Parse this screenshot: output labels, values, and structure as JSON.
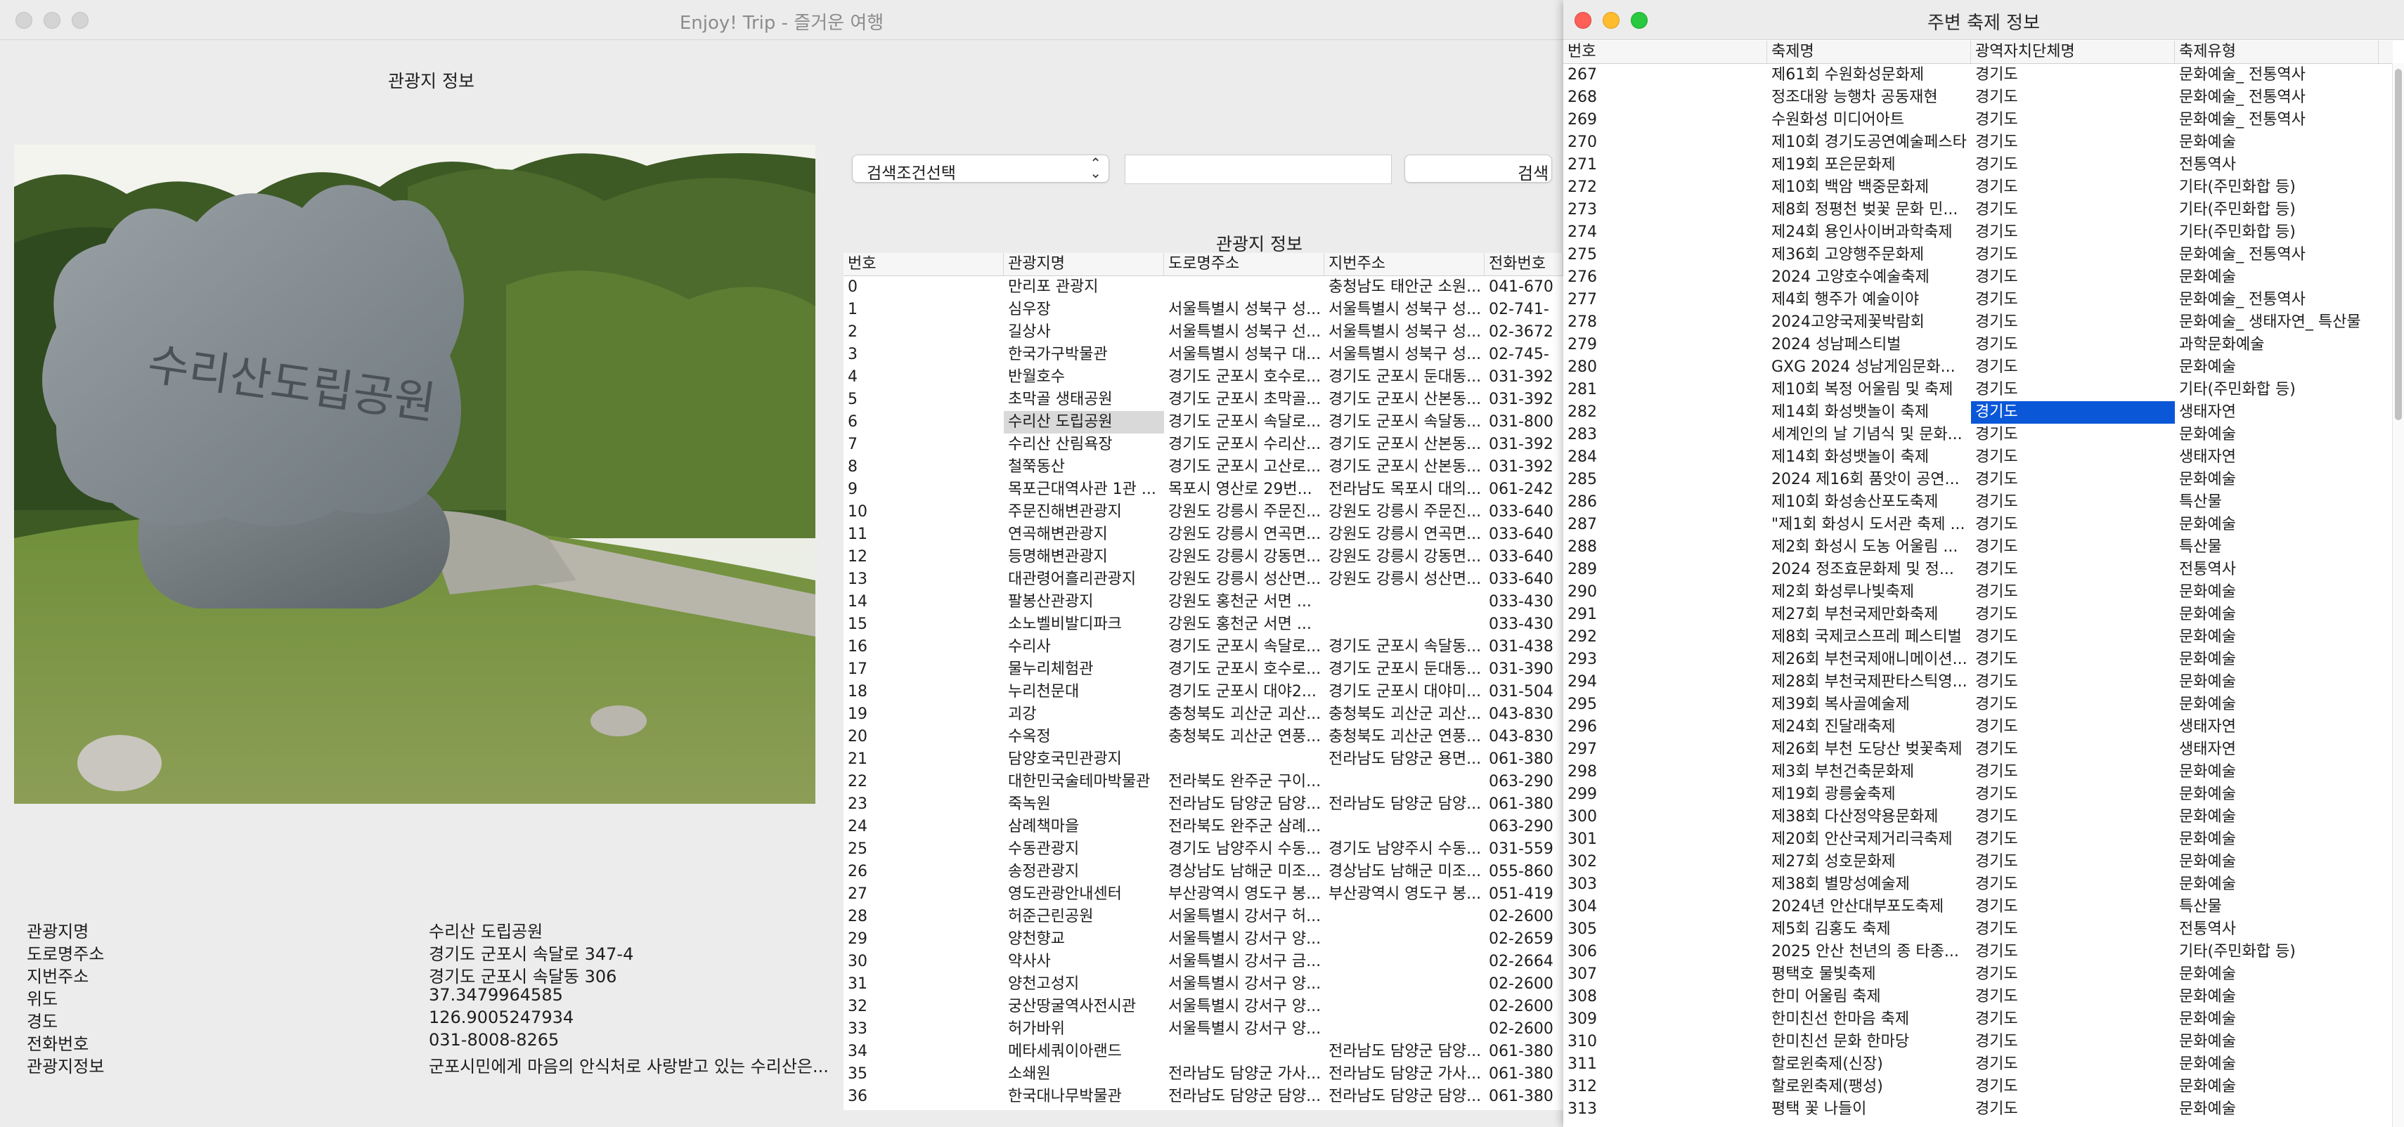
{
  "main_window": {
    "title": "Enjoy! Trip - 즐거운 여행",
    "heading": "관광지 정보",
    "detail": [
      {
        "label": "관광지명",
        "value": "수리산 도립공원"
      },
      {
        "label": "도로명주소",
        "value": "경기도 군포시 속달로 347-4"
      },
      {
        "label": "지번주소",
        "value": "경기도 군포시 속달동 306"
      },
      {
        "label": "위도",
        "value": "37.3479964585"
      },
      {
        "label": "경도",
        "value": "126.9005247934"
      },
      {
        "label": "전화번호",
        "value": "031-8008-8265"
      },
      {
        "label": "관광지정보",
        "value": "군포시민에게 마음의 안식처로 사랑받고 있는 수리산은..."
      }
    ],
    "photo_sign_text": "수리산도립공원"
  },
  "search": {
    "condition_select": "검색조건선택",
    "input_value": "",
    "button_label": "검색"
  },
  "attraction_table": {
    "caption": "관광지 정보",
    "columns": [
      "번호",
      "관광지명",
      "도로명주소",
      "지번주소",
      "전화번호"
    ],
    "selected_row": 6,
    "rows": [
      [
        "0",
        "만리포 관광지",
        "",
        "충청남도 태안군 소원...",
        "041-670"
      ],
      [
        "1",
        "심우장",
        "서울특별시 성북구 성...",
        "서울특별시 성북구 성...",
        "02-741-"
      ],
      [
        "2",
        "길상사",
        "서울특별시 성북구 선...",
        "서울특별시 성북구 성...",
        "02-3672"
      ],
      [
        "3",
        "한국가구박물관",
        "서울특별시 성북구 대...",
        "서울특별시 성북구 성...",
        "02-745-"
      ],
      [
        "4",
        "반월호수",
        "경기도 군포시 호수로...",
        "경기도 군포시 둔대동...",
        "031-392"
      ],
      [
        "5",
        "초막골 생태공원",
        "경기도 군포시 초막골...",
        "경기도 군포시 산본동...",
        "031-392"
      ],
      [
        "6",
        "수리산 도립공원",
        "경기도 군포시 속달로...",
        "경기도 군포시 속달동...",
        "031-800"
      ],
      [
        "7",
        "수리산 산림욕장",
        "경기도 군포시 수리산...",
        "경기도 군포시 산본동...",
        "031-392"
      ],
      [
        "8",
        "철쭉동산",
        "경기도 군포시 고산로...",
        "경기도 군포시 산본동...",
        "031-392"
      ],
      [
        "9",
        "목포근대역사관 1관 ...",
        "목포시 영산로 29번...",
        "전라남도 목포시 대의...",
        "061-242"
      ],
      [
        "10",
        "주문진해변관광지",
        "강원도 강릉시 주문진...",
        "강원도 강릉시 주문진...",
        "033-640"
      ],
      [
        "11",
        "연곡해변관광지",
        "강원도 강릉시 연곡면...",
        "강원도 강릉시 연곡면...",
        "033-640"
      ],
      [
        "12",
        "등명해변관광지",
        "강원도 강릉시 강동면...",
        "강원도 강릉시 강동면...",
        "033-640"
      ],
      [
        "13",
        "대관령어흘리관광지",
        "강원도 강릉시 성산면...",
        "강원도 강릉시 성산면...",
        "033-640"
      ],
      [
        "14",
        "팔봉산관광지",
        "강원도 홍천군 서면 ...",
        "",
        "033-430"
      ],
      [
        "15",
        "소노벨비발디파크",
        "강원도 홍천군 서면 ...",
        "",
        "033-430"
      ],
      [
        "16",
        "수리사",
        "경기도 군포시 속달로...",
        "경기도 군포시 속달동...",
        "031-438"
      ],
      [
        "17",
        "물누리체험관",
        "경기도 군포시 호수로...",
        "경기도 군포시 둔대동...",
        "031-390"
      ],
      [
        "18",
        "누리천문대",
        "경기도 군포시 대야2...",
        "경기도 군포시 대야미...",
        "031-504"
      ],
      [
        "19",
        "괴강",
        "충청북도 괴산군 괴산...",
        "충청북도 괴산군 괴산...",
        "043-830"
      ],
      [
        "20",
        "수옥정",
        "충청북도 괴산군 연풍...",
        "충청북도 괴산군 연풍...",
        "043-830"
      ],
      [
        "21",
        "담양호국민관광지",
        "",
        "전라남도 담양군 용면...",
        "061-380"
      ],
      [
        "22",
        "대한민국술테마박물관",
        "전라북도 완주군 구이...",
        "",
        "063-290"
      ],
      [
        "23",
        "죽녹원",
        "전라남도 담양군 담양...",
        "전라남도 담양군 담양...",
        "061-380"
      ],
      [
        "24",
        "삼례책마을",
        "전라북도 완주군 삼례...",
        "",
        "063-290"
      ],
      [
        "25",
        "수동관광지",
        "경기도 남양주시 수동...",
        "경기도 남양주시 수동...",
        "031-559"
      ],
      [
        "26",
        "송정관광지",
        "경상남도 남해군 미조...",
        "경상남도 남해군 미조...",
        "055-860"
      ],
      [
        "27",
        "영도관광안내센터",
        "부산광역시 영도구 봉...",
        "부산광역시 영도구 봉...",
        "051-419"
      ],
      [
        "28",
        "허준근린공원",
        "서울특별시 강서구 허...",
        "",
        "02-2600"
      ],
      [
        "29",
        "양천향교",
        "서울특별시 강서구 양...",
        "",
        "02-2659"
      ],
      [
        "30",
        "약사사",
        "서울특별시 강서구 금...",
        "",
        "02-2664"
      ],
      [
        "31",
        "양천고성지",
        "서울특별시 강서구 양...",
        "",
        "02-2600"
      ],
      [
        "32",
        "궁산땅굴역사전시관",
        "서울특별시 강서구 양...",
        "",
        "02-2600"
      ],
      [
        "33",
        "허가바위",
        "서울특별시 강서구 양...",
        "",
        "02-2600"
      ],
      [
        "34",
        "메타세쿼이아랜드",
        "",
        "전라남도 담양군 담양...",
        "061-380"
      ],
      [
        "35",
        "소쇄원",
        "전라남도 담양군 가사...",
        "전라남도 담양군 가사...",
        "061-380"
      ],
      [
        "36",
        "한국대나무박물관",
        "전라남도 담양군 담양...",
        "전라남도 담양군 담양...",
        "061-380"
      ]
    ]
  },
  "festival_window": {
    "title": "주변 축제 정보",
    "columns": [
      "번호",
      "축제명",
      "광역자치단체명",
      "축제유형"
    ],
    "selected_row_number": "282",
    "rows": [
      [
        "267",
        "제61회 수원화성문화제",
        "경기도",
        "문화예술_ 전통역사"
      ],
      [
        "268",
        "정조대왕 능행차 공동재현",
        "경기도",
        "문화예술_ 전통역사"
      ],
      [
        "269",
        "수원화성 미디어아트",
        "경기도",
        "문화예술_ 전통역사"
      ],
      [
        "270",
        "제10회 경기도공연예술페스타",
        "경기도",
        "문화예술"
      ],
      [
        "271",
        "제19회 포은문화제",
        "경기도",
        "전통역사"
      ],
      [
        "272",
        "제10회 백암 백중문화제",
        "경기도",
        "기타(주민화합 등)"
      ],
      [
        "273",
        "제8회 정평천 벚꽃 문화 민...",
        "경기도",
        "기타(주민화합 등)"
      ],
      [
        "274",
        "제24회 용인사이버과학축제",
        "경기도",
        "기타(주민화합 등)"
      ],
      [
        "275",
        "제36회 고양행주문화제",
        "경기도",
        "문화예술_ 전통역사"
      ],
      [
        "276",
        "2024 고양호수예술축제",
        "경기도",
        "문화예술"
      ],
      [
        "277",
        "제4회 행주가 예술이야",
        "경기도",
        "문화예술_ 전통역사"
      ],
      [
        "278",
        "2024고양국제꽃박람회",
        "경기도",
        "문화예술_ 생태자연_ 특산물"
      ],
      [
        "279",
        "2024 성남페스티벌",
        "경기도",
        "과학문화예술"
      ],
      [
        "280",
        "GXG 2024 성남게임문화...",
        "경기도",
        "문화예술"
      ],
      [
        "281",
        "제10회 복정 어울림 및 축제",
        "경기도",
        "기타(주민화합 등)"
      ],
      [
        "282",
        "제14회 화성뱃놀이 축제",
        "경기도",
        "생태자연"
      ],
      [
        "283",
        "세계인의 날 기념식 및 문화...",
        "경기도",
        "문화예술"
      ],
      [
        "284",
        "제14회 화성뱃놀이 축제",
        "경기도",
        "생태자연"
      ],
      [
        "285",
        "2024 제16회 품앗이 공연...",
        "경기도",
        "문화예술"
      ],
      [
        "286",
        "제10회 화성송산포도축제",
        "경기도",
        "특산물"
      ],
      [
        "287",
        "\"제1회 화성시 도서관 축제 ...",
        "경기도",
        "문화예술"
      ],
      [
        "288",
        "제2회 화성시 도농 어울림 ...",
        "경기도",
        "특산물"
      ],
      [
        "289",
        "2024 정조효문화제 및 정...",
        "경기도",
        "전통역사"
      ],
      [
        "290",
        "제2회 화성루나빛축제",
        "경기도",
        "문화예술"
      ],
      [
        "291",
        "제27회 부천국제만화축제",
        "경기도",
        "문화예술"
      ],
      [
        "292",
        "제8회 국제코스프레 페스티벌",
        "경기도",
        "문화예술"
      ],
      [
        "293",
        "제26회 부천국제애니메이션...",
        "경기도",
        "문화예술"
      ],
      [
        "294",
        "제28회 부천국제판타스틱영...",
        "경기도",
        "문화예술"
      ],
      [
        "295",
        "제39회 복사골예술제",
        "경기도",
        "문화예술"
      ],
      [
        "296",
        "제24회 진달래축제",
        "경기도",
        "생태자연"
      ],
      [
        "297",
        "제26회 부천 도당산 벚꽃축제",
        "경기도",
        "생태자연"
      ],
      [
        "298",
        "제3회 부천건축문화제",
        "경기도",
        "문화예술"
      ],
      [
        "299",
        "제19회 광릉숲축제",
        "경기도",
        "문화예술"
      ],
      [
        "300",
        "제38회 다산정약용문화제",
        "경기도",
        "문화예술"
      ],
      [
        "301",
        "제20회 안산국제거리극축제",
        "경기도",
        "문화예술"
      ],
      [
        "302",
        "제27회 성호문화제",
        "경기도",
        "문화예술"
      ],
      [
        "303",
        "제38회 별망성예술제",
        "경기도",
        "문화예술"
      ],
      [
        "304",
        "2024년 안산대부포도축제",
        "경기도",
        "특산물"
      ],
      [
        "305",
        "제5회 김홍도 축제",
        "경기도",
        "전통역사"
      ],
      [
        "306",
        "2025 안산 천년의 종 타종...",
        "경기도",
        "기타(주민화합 등)"
      ],
      [
        "307",
        "평택호 물빛축제",
        "경기도",
        "문화예술"
      ],
      [
        "308",
        "한미 어울림 축제",
        "경기도",
        "문화예술"
      ],
      [
        "309",
        "한미친선 한마음 축제",
        "경기도",
        "문화예술"
      ],
      [
        "310",
        "한미친선 문화 한마당",
        "경기도",
        "문화예술"
      ],
      [
        "311",
        "할로윈축제(신장)",
        "경기도",
        "문화예술"
      ],
      [
        "312",
        "할로윈축제(팽성)",
        "경기도",
        "문화예술"
      ],
      [
        "313",
        "평택 꽃 나들이",
        "경기도",
        "문화예술"
      ]
    ]
  },
  "colors": {
    "window_bg": "#ececec",
    "selection_blue": "#0a57d8",
    "selection_gray": "#d9d9d9"
  }
}
